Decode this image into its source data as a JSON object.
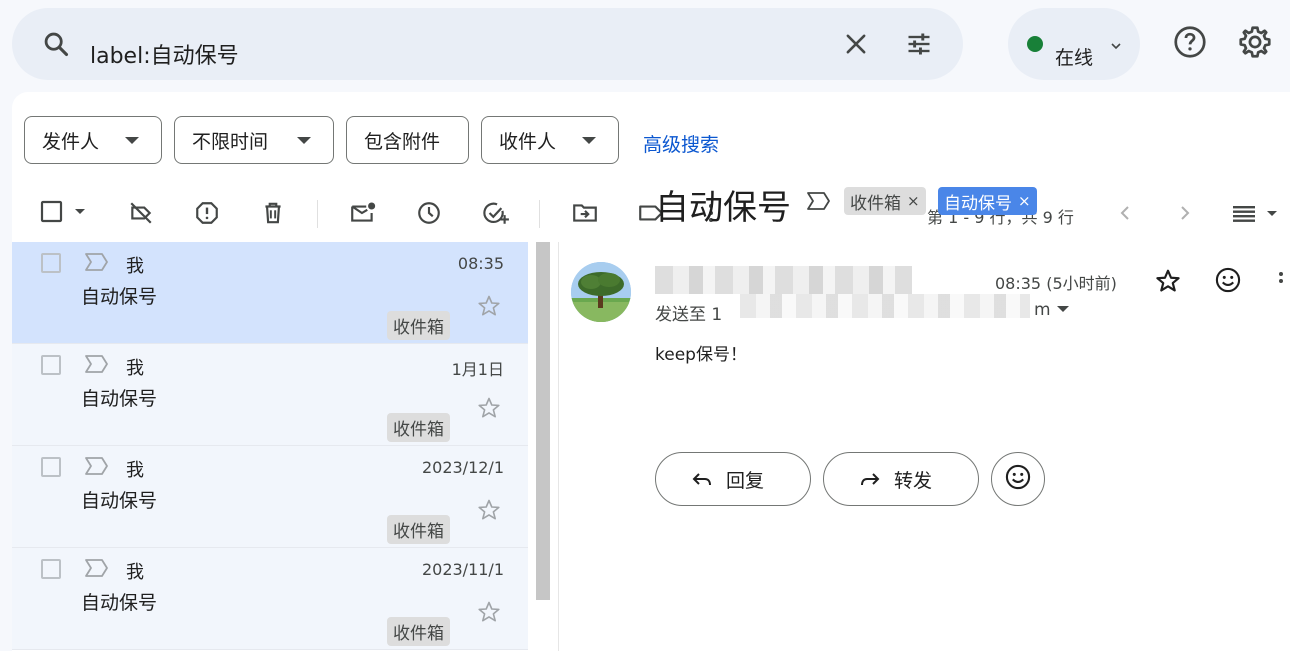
{
  "search": {
    "query": "label:自动保号"
  },
  "status": {
    "label": "在线",
    "color": "#188038"
  },
  "filters": {
    "sender": "发件人",
    "time": "不限时间",
    "has_attachment": "包含附件",
    "recipient": "收件人",
    "advanced": "高级搜索"
  },
  "toolbar": {
    "page_info": "第 1 - 9 行，共 9 行"
  },
  "emails": [
    {
      "sender": "我",
      "subject": "自动保号",
      "date": "08:35",
      "label": "收件箱",
      "selected": true
    },
    {
      "sender": "我",
      "subject": "自动保号",
      "date": "1月1日",
      "label": "收件箱",
      "selected": false
    },
    {
      "sender": "我",
      "subject": "自动保号",
      "date": "2023/12/1",
      "label": "收件箱",
      "selected": false
    },
    {
      "sender": "我",
      "subject": "自动保号",
      "date": "2023/11/1",
      "label": "收件箱",
      "selected": false
    }
  ],
  "reading": {
    "subject": "自动保号",
    "tags": [
      {
        "label": "收件箱",
        "remove": "×"
      },
      {
        "label": "自动保号",
        "remove": "×"
      }
    ],
    "time": "08:35 (5小时前)",
    "to_prefix": "发送至 1",
    "to_suffix": "m",
    "body": "keep保号！",
    "reply_label": "回复",
    "forward_label": "转发"
  },
  "colors": {
    "accent": "#0b57d0",
    "selected_row": "#d3e3fd",
    "tag_blue": "#4a86e8"
  }
}
